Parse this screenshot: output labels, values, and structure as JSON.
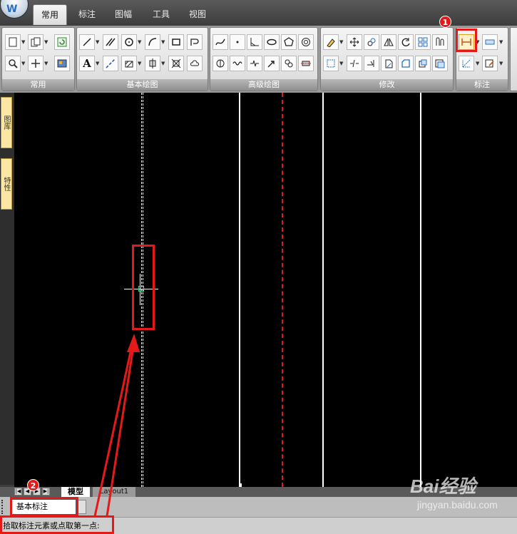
{
  "app": {
    "logo_letter": "W"
  },
  "tabs": [
    "常用",
    "标注",
    "图幅",
    "工具",
    "视图"
  ],
  "active_tab": "常用",
  "ribbon": {
    "panels": [
      "常用",
      "基本绘图",
      "高级绘图",
      "修改",
      "标注"
    ],
    "draw_text_tool": "A"
  },
  "sidebar": {
    "tab1": "图库",
    "tab2": "特性"
  },
  "layout_tabs": {
    "model": "模型",
    "layout1": "Layout1"
  },
  "command": {
    "input_value": "基本标注",
    "status_text": "拾取标注元素或点取第一点:"
  },
  "annotations": {
    "badge1": "1",
    "badge2": "2"
  },
  "watermark": {
    "brand": "Bai经验",
    "site": "jingyan.baidu.com"
  },
  "colors": {
    "highlight": "#e41a1a",
    "centerline": "#d81e1e",
    "canvas": "#000000",
    "cursor": "#2bd66a"
  }
}
